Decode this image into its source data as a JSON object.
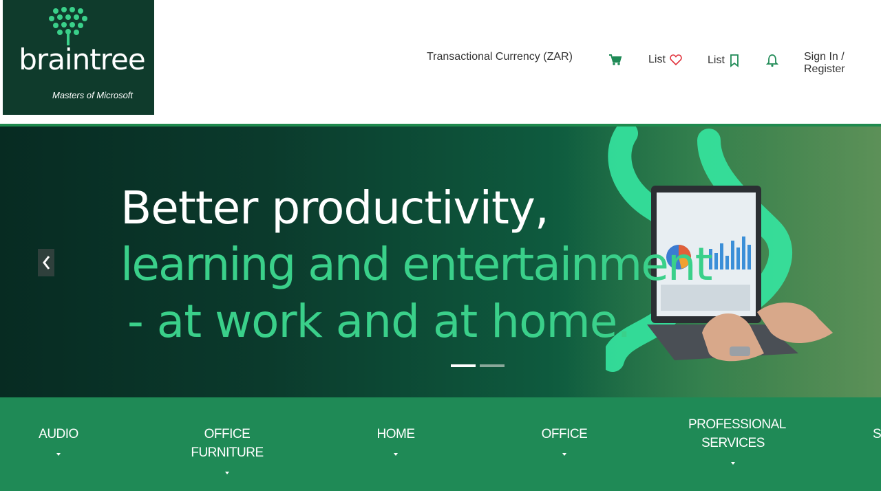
{
  "brand": {
    "name": "braintree",
    "tagline": "Masters of Microsoft",
    "dark_color": "#0f3b2c",
    "accent_color": "#3ad08a"
  },
  "header": {
    "currency": "Transactional Currency (ZAR)",
    "cart_icon": "cart-icon",
    "wishlist_label": "List",
    "wishlist_icon": "heart-icon",
    "savedlist_label": "List",
    "savedlist_icon": "bookmark-icon",
    "notifications_icon": "bell-icon",
    "signin": "Sign In / Register"
  },
  "hero": {
    "line1": "Better productivity,",
    "line2": "learning and entertainment",
    "line3": "- at work and at home.",
    "prev_icon": "chevron-left-icon",
    "slides_total": 2,
    "active_slide": 1
  },
  "categories": [
    {
      "label": "AUDIO"
    },
    {
      "label": "OFFICE FURNITURE"
    },
    {
      "label": "HOME"
    },
    {
      "label": "OFFICE"
    },
    {
      "label": "PROFESSIONAL SERVICES"
    },
    {
      "label": "S"
    }
  ]
}
